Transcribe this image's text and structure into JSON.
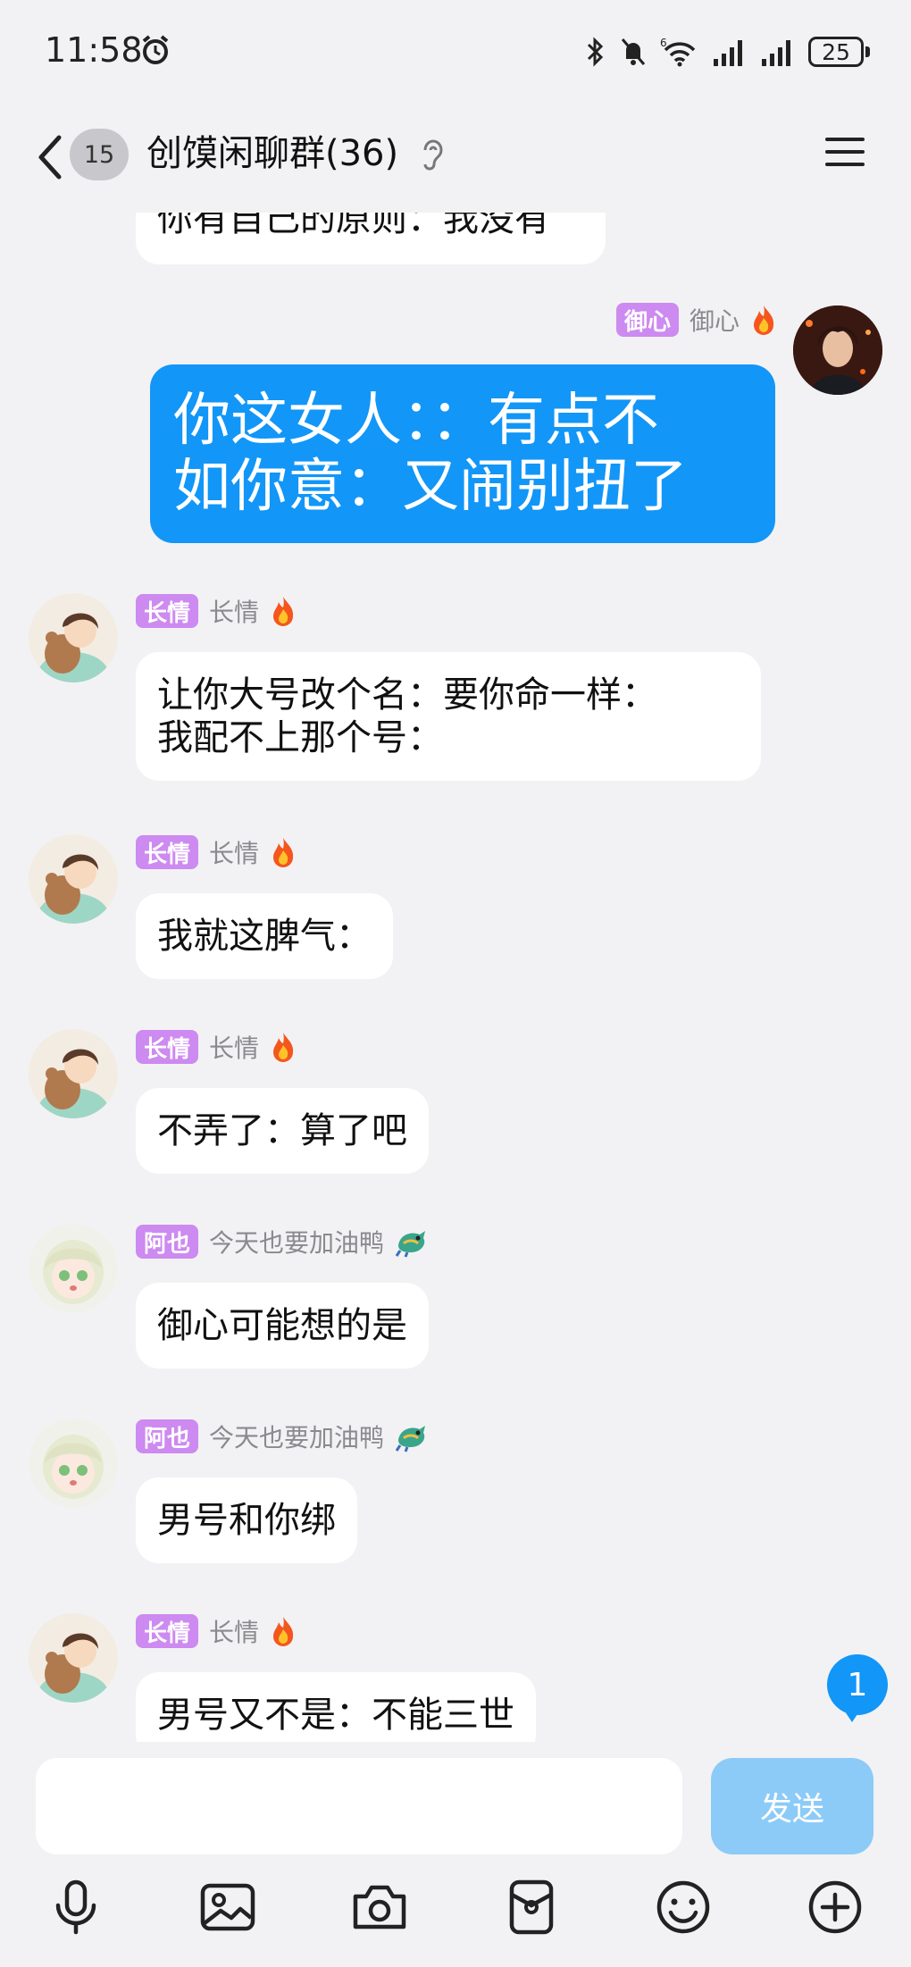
{
  "status_bar": {
    "time": "11:58",
    "battery": "25",
    "network_label": "6"
  },
  "header": {
    "unread_count": "15",
    "title": "创馍闲聊群(36)"
  },
  "messages": [
    {
      "type": "partial",
      "text": "你有自己的原则：我没有"
    },
    {
      "type": "self",
      "tag": "御心",
      "nick": "御心",
      "text_line1": "你这女人：：有点不",
      "text_line2": "如你意：又闹别扭了"
    },
    {
      "type": "other",
      "tag": "长情",
      "nick": "长情",
      "text_line1": "让你大号改个名：要你命一样：",
      "text_line2": "我配不上那个号："
    },
    {
      "type": "other",
      "tag": "长情",
      "nick": "长情",
      "text": "我就这脾气："
    },
    {
      "type": "other",
      "tag": "长情",
      "nick": "长情",
      "text": "不弄了：算了吧"
    },
    {
      "type": "other",
      "tag": "阿也",
      "nick": "今天也要加油鸭",
      "text": "御心可能想的是"
    },
    {
      "type": "other",
      "tag": "阿也",
      "nick": "今天也要加油鸭",
      "text": "男号和你绑"
    },
    {
      "type": "other",
      "tag": "长情",
      "nick": "长情",
      "text": "男号又不是：不能三世"
    }
  ],
  "new_message_count": "1",
  "input": {
    "value": "",
    "send_label": "发送"
  },
  "toolbar": [
    "microphone-icon",
    "image-icon",
    "camera-icon",
    "red-packet-icon",
    "emoji-icon",
    "plus-icon"
  ],
  "colors": {
    "accent": "#1296f7",
    "tag": "#cd8af0",
    "background": "#f2f2f4",
    "send_disabled": "#8ccbf7"
  }
}
